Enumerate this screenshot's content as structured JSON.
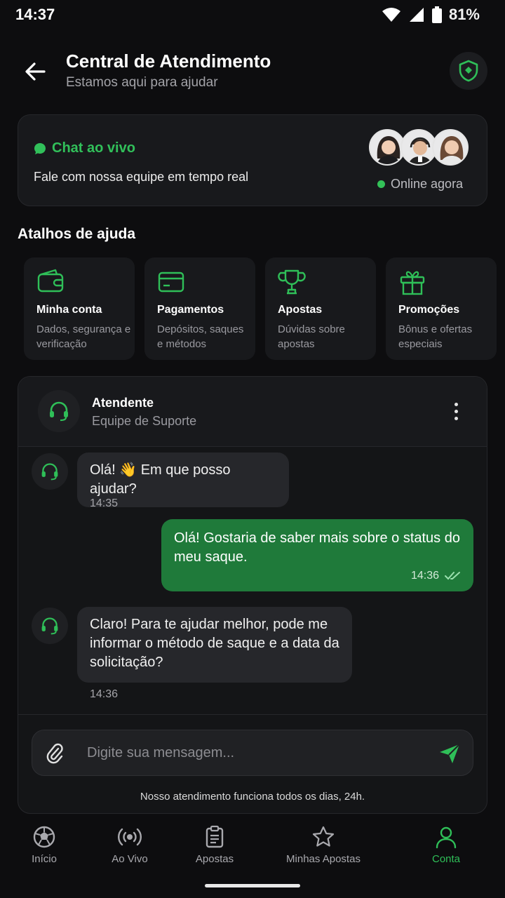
{
  "status_bar": {
    "time": "14:37",
    "battery": "81%"
  },
  "header": {
    "title": "Central de Atendimento",
    "subtitle": "Estamos aqui para ajudar"
  },
  "live_chat": {
    "title": "Chat ao vivo",
    "description": "Fale com nossa equipe em tempo real",
    "status": "Online agora"
  },
  "shortcuts": {
    "title": "Atalhos de ajuda",
    "items": [
      {
        "icon": "wallet-icon",
        "title": "Minha conta",
        "desc": "Dados, segurança e verificação"
      },
      {
        "icon": "card-icon",
        "title": "Pagamentos",
        "desc": "Depósitos, saques e métodos"
      },
      {
        "icon": "trophy-icon",
        "title": "Apostas",
        "desc": "Dúvidas sobre apostas"
      },
      {
        "icon": "gift-icon",
        "title": "Promoções",
        "desc": "Bônus e ofertas especiais"
      }
    ]
  },
  "chat": {
    "agent_name": "Atendente",
    "agent_role": "Equipe de Suporte",
    "messages": [
      {
        "from": "agent",
        "text": "Olá! 👋 Em que posso ajudar?",
        "time": "14:35"
      },
      {
        "from": "user",
        "text": "Olá! Gostaria de saber mais sobre o status do meu saque.",
        "time": "14:36"
      },
      {
        "from": "agent",
        "text": "Claro! Para te ajudar melhor, pode me informar o método de saque e a data da solicitação?",
        "time": "14:36"
      }
    ],
    "input_placeholder": "Digite sua mensagem...",
    "support_hours": "Nosso atendimento funciona todos os dias, 24h."
  },
  "bottom_nav": {
    "items": [
      {
        "label": "Início",
        "icon": "soccer-ball-icon"
      },
      {
        "label": "Ao Vivo",
        "icon": "broadcast-icon"
      },
      {
        "label": "Apostas",
        "icon": "clipboard-icon"
      },
      {
        "label": "Minhas Apostas",
        "icon": "star-icon"
      },
      {
        "label": "Conta",
        "icon": "user-icon"
      }
    ],
    "active": "Conta"
  },
  "colors": {
    "accent": "#2fbf58",
    "user_bubble": "#1f7a3a",
    "background": "#0d0d0f",
    "card": "#18191c"
  }
}
